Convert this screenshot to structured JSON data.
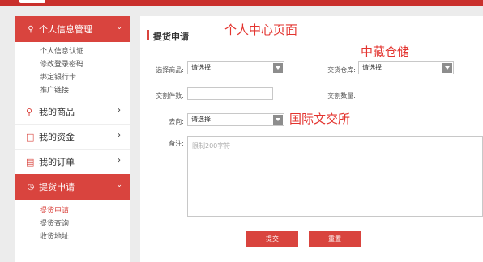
{
  "annotations": {
    "personal_center": "个人中心页面",
    "storage": "中藏仓储",
    "intl_exchange": "国际文交所"
  },
  "sidebar": {
    "personal_info": {
      "label": "个人信息管理",
      "icon": "user-icon",
      "items": [
        "个人信息认证",
        "修改登录密码",
        "绑定银行卡",
        "推广链接"
      ]
    },
    "my_products": {
      "label": "我的商品",
      "icon": "user-tag-icon"
    },
    "my_funds": {
      "label": "我的资金",
      "icon": "wallet-icon"
    },
    "my_orders": {
      "label": "我的订单",
      "icon": "document-icon"
    },
    "pickup": {
      "label": "提货申请",
      "icon": "clock-icon",
      "items": [
        "提货申请",
        "提货查询",
        "收货地址"
      ]
    }
  },
  "main": {
    "title": "提货申请",
    "form": {
      "goods_label": "选择商品:",
      "goods_value": "请选择",
      "warehouse_label": "交货仓库:",
      "warehouse_value": "请选择",
      "pieces_label": "交割件数:",
      "quantity_label": "交割数量:",
      "destination_label": "去向:",
      "destination_value": "请选择",
      "remark_label": "备注:",
      "remark_placeholder": "限制200字符"
    },
    "buttons": {
      "submit": "提交",
      "reset": "重置"
    }
  },
  "colors": {
    "accent": "#d9443e",
    "annotation": "#e3342f"
  }
}
